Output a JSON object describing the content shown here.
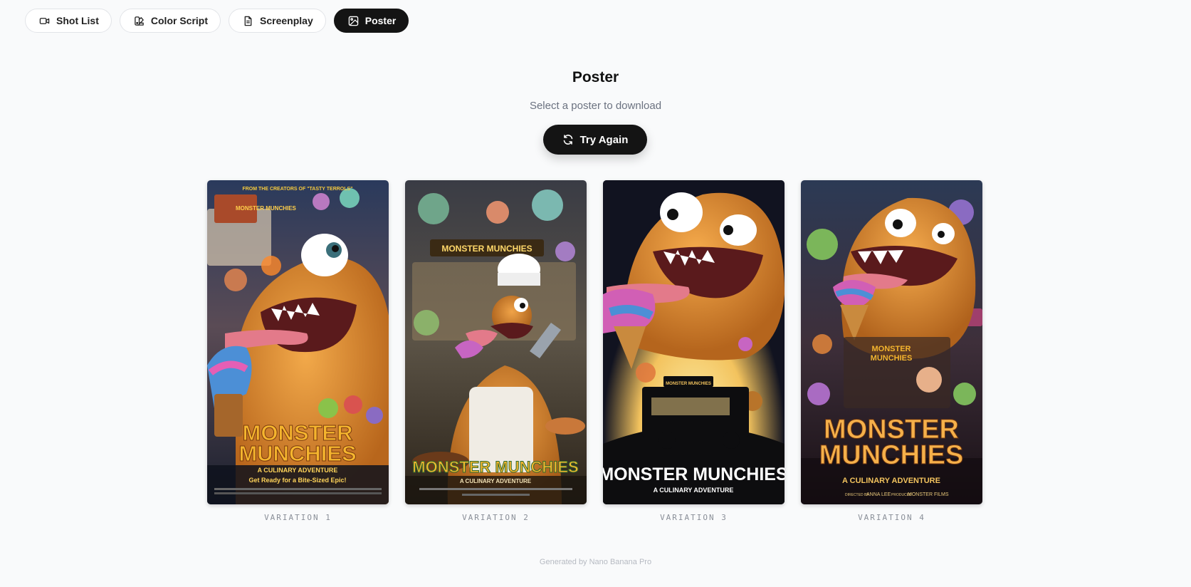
{
  "tabs": [
    {
      "label": "Shot List",
      "icon": "video-camera-icon"
    },
    {
      "label": "Color Script",
      "icon": "palette-icon"
    },
    {
      "label": "Screenplay",
      "icon": "document-icon"
    },
    {
      "label": "Poster",
      "icon": "image-icon",
      "active": true
    }
  ],
  "page": {
    "title": "Poster",
    "subtitle": "Select a poster to download",
    "try_again_label": "Try Again"
  },
  "posters": [
    {
      "caption": "VARIATION 1",
      "tagline_top": "FROM THE CREATORS OF \"TASTY TERROLS\"",
      "title_line1": "MONSTER",
      "title_line2": "MUNCHIES",
      "subtitle": "A CULINARY ADVENTURE",
      "tagline": "Get Ready for a Bite-Sized Epic!",
      "sign": "MONSTER MUNCHIES"
    },
    {
      "caption": "VARIATION 2",
      "sign": "MONSTER MUNCHIES",
      "title_line1": "MONSTER MUNCHIES",
      "subtitle": "A CULINARY ADVENTURE"
    },
    {
      "caption": "VARIATION 3",
      "truck_sign": "MONSTER MUNCHIES",
      "title_line1": "MONSTER MUNCHIES",
      "subtitle": "A CULINARY ADVENTURE"
    },
    {
      "caption": "VARIATION 4",
      "sign_line1": "MONSTER",
      "sign_line2": "MUNCHIES",
      "title_line1": "MONSTER",
      "title_line2": "MUNCHIES",
      "subtitle": "A CULINARY ADVENTURE",
      "credit_director_label": "DIRECTED BY",
      "credit_director": "ANNA LEE",
      "credit_producer_label": "PRODUCED",
      "credit_producer": "MONSTER FILMS"
    }
  ],
  "footer": "Generated by Nano Banana Pro",
  "colors": {
    "accent_dark": "#141414",
    "monster_fur": "#e08f2e",
    "title_gold": "#f5b52e"
  }
}
